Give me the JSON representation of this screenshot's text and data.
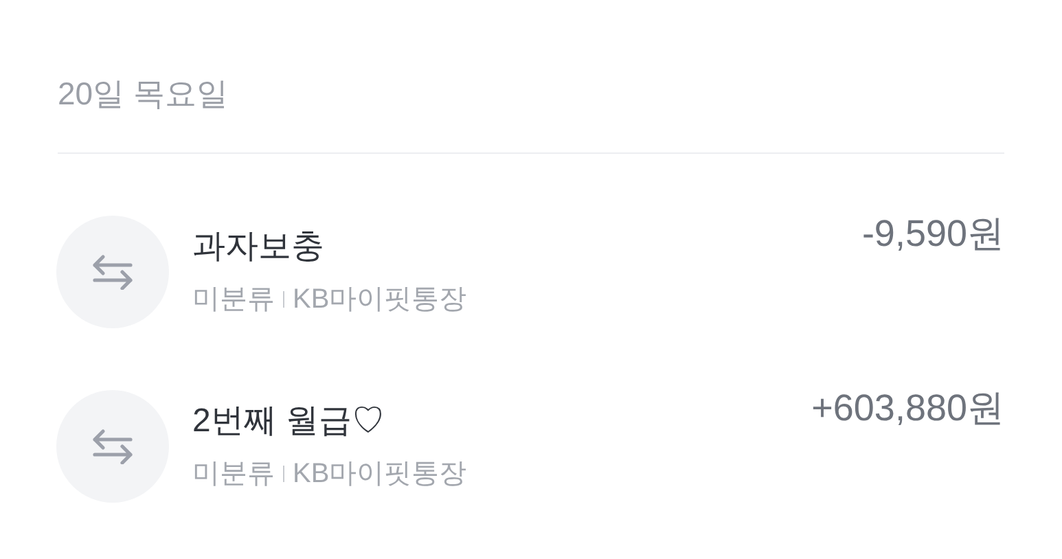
{
  "date_header": "20일 목요일",
  "transactions": [
    {
      "title": "과자보충",
      "category": "미분류",
      "account": "KB마이핏통장",
      "amount": "-9,590원"
    },
    {
      "title": "2번째 월급♡",
      "category": "미분류",
      "account": "KB마이핏통장",
      "amount": "+603,880원"
    }
  ]
}
